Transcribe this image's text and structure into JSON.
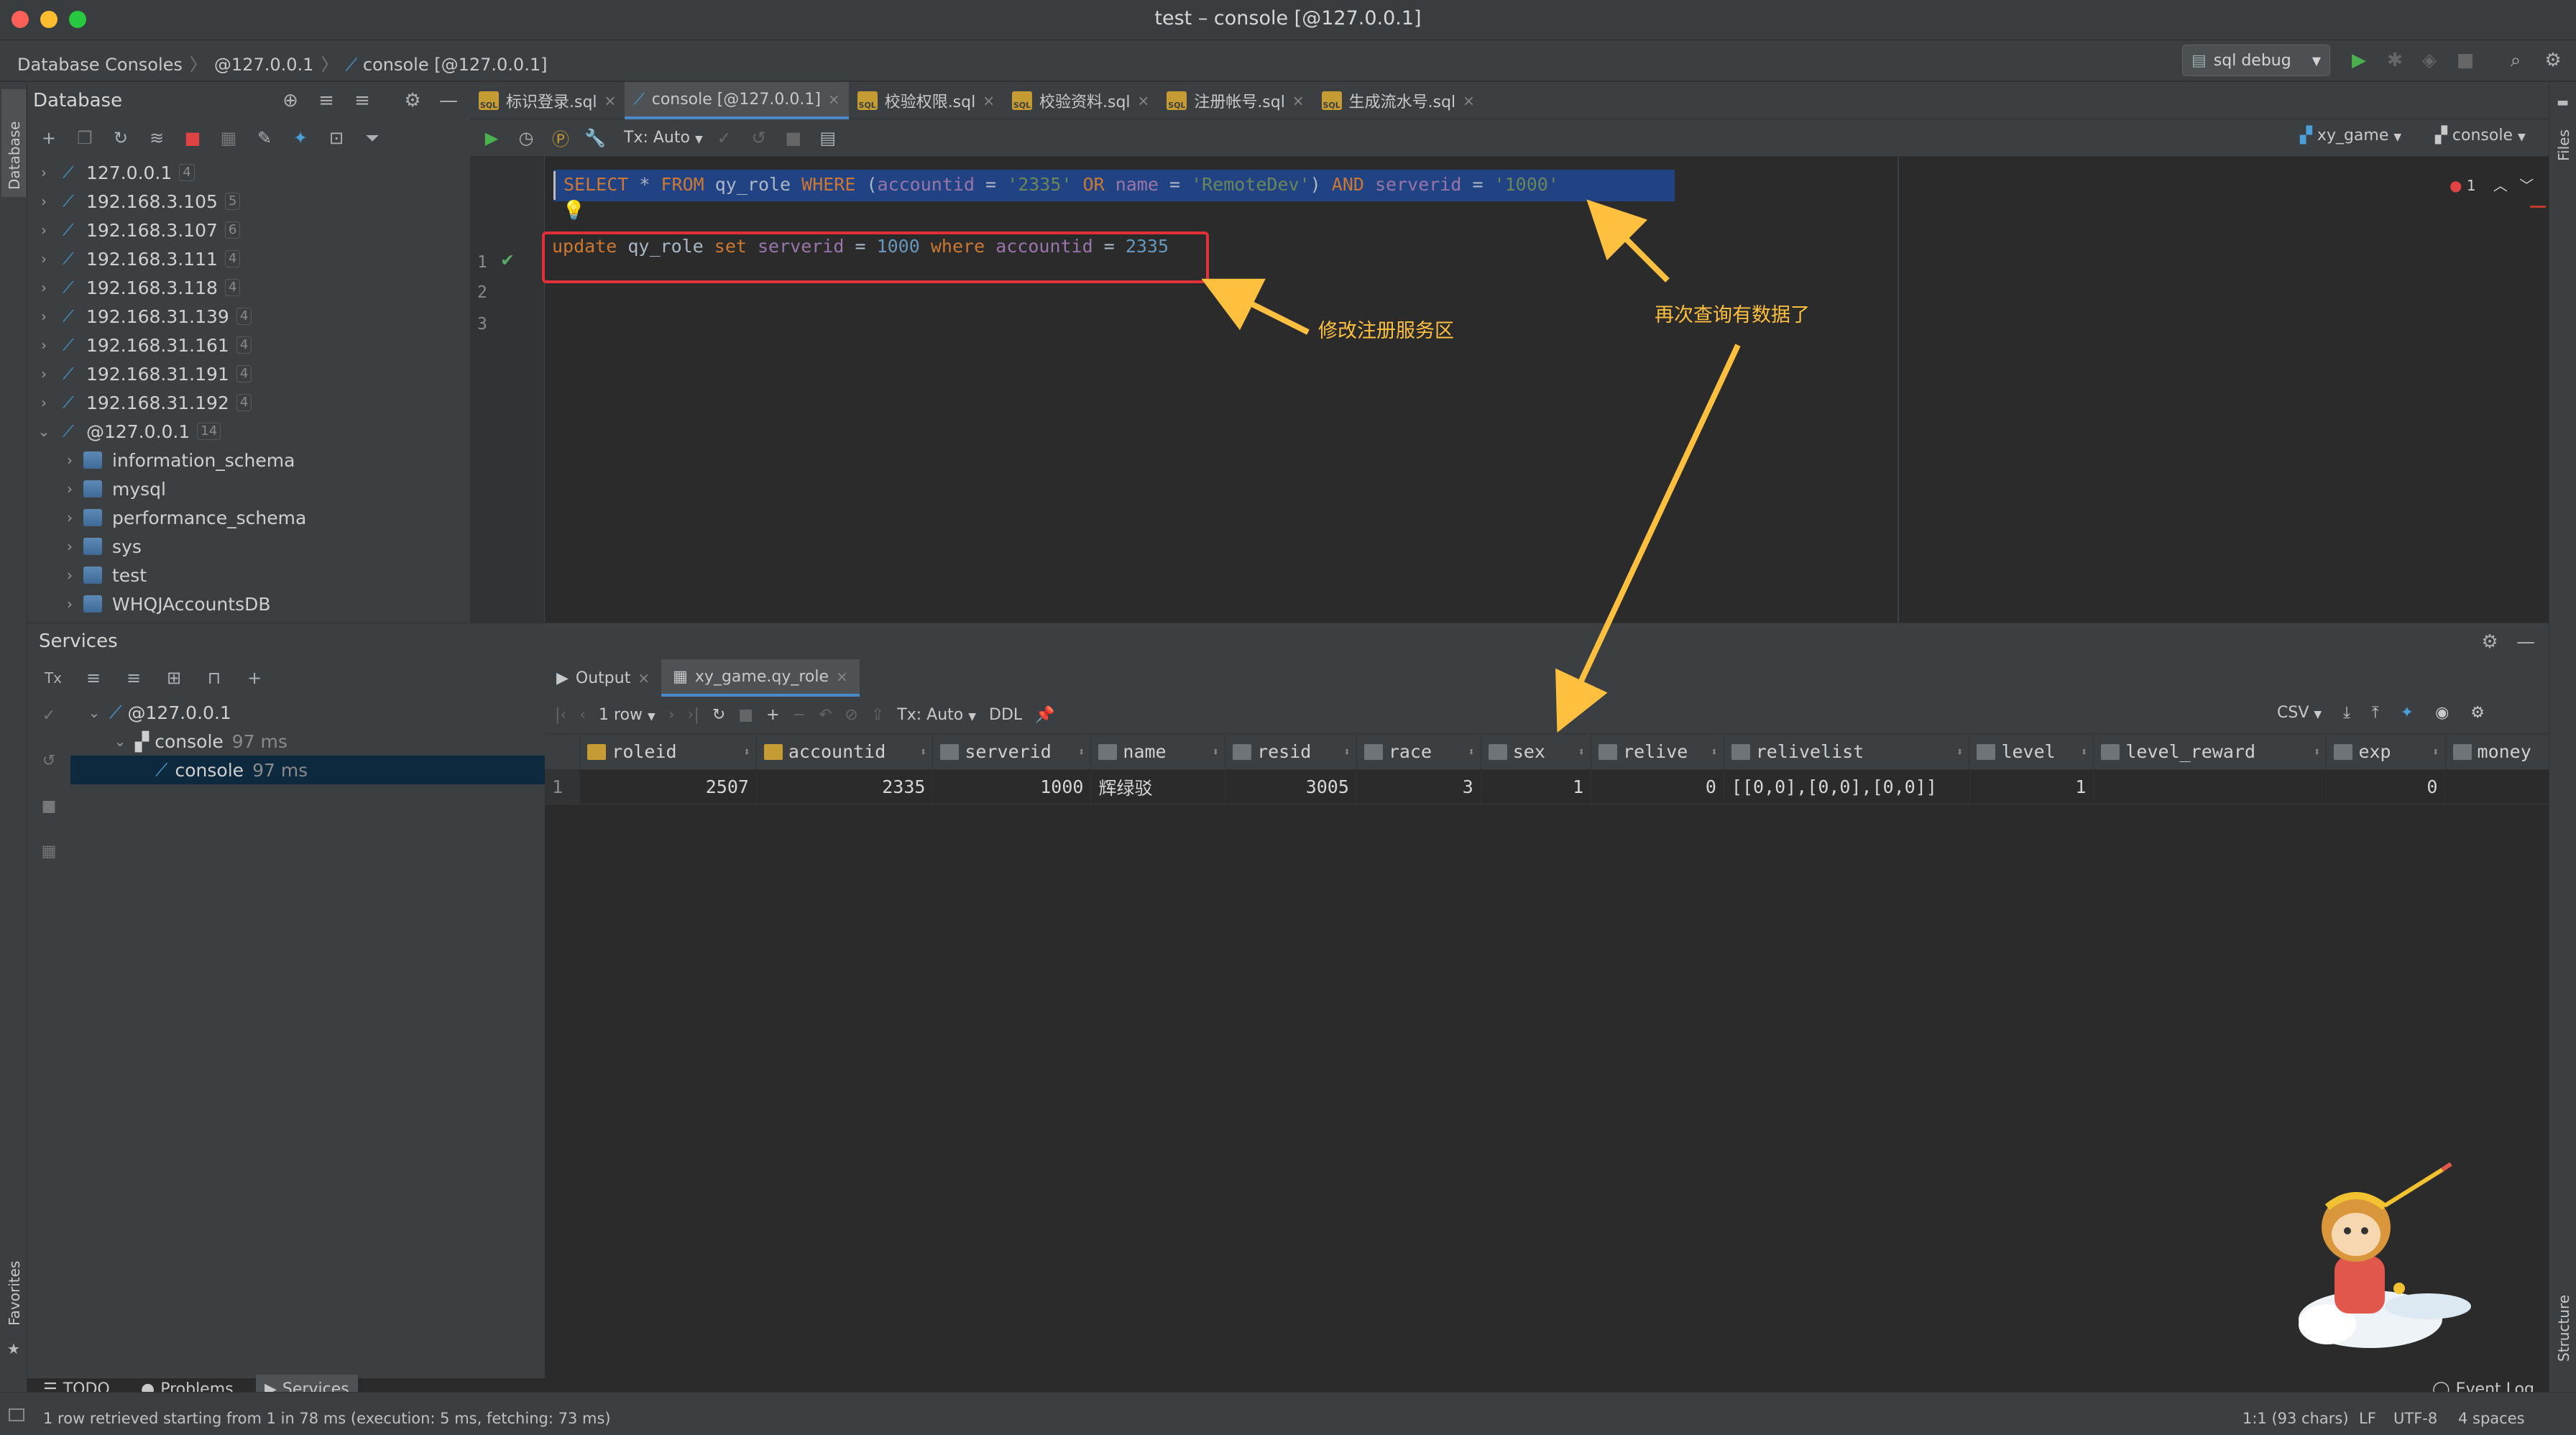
{
  "window": {
    "title": "test – console [@127.0.0.1]"
  },
  "navbar": {
    "crumbs": [
      "Database Consoles",
      "@127.0.0.1",
      "console [@127.0.0.1]"
    ],
    "run_config": "sql debug"
  },
  "db_panel": {
    "title": "Database",
    "tree": [
      {
        "label": "127.0.0.1",
        "count": "4"
      },
      {
        "label": "192.168.3.105",
        "count": "5"
      },
      {
        "label": "192.168.3.107",
        "count": "6"
      },
      {
        "label": "192.168.3.111",
        "count": "4"
      },
      {
        "label": "192.168.3.118",
        "count": "4"
      },
      {
        "label": "192.168.31.139",
        "count": "4"
      },
      {
        "label": "192.168.31.161",
        "count": "4"
      },
      {
        "label": "192.168.31.191",
        "count": "4"
      },
      {
        "label": "192.168.31.192",
        "count": "4"
      },
      {
        "label": "@127.0.0.1",
        "count": "14"
      }
    ],
    "schemas": [
      "information_schema",
      "mysql",
      "performance_schema",
      "sys",
      "test",
      "WHQJAccountsDB"
    ]
  },
  "editor": {
    "tabs": [
      "标识登录.sql",
      "console [@127.0.0.1]",
      "校验权限.sql",
      "校验资料.sql",
      "注册帐号.sql",
      "生成流水号.sql"
    ],
    "tx_mode": "Tx: Auto",
    "schema_selector": "xy_game",
    "console_selector": "console",
    "problems_count": "1",
    "lines": [
      "1",
      "2",
      "3"
    ],
    "line1": {
      "t1": "SELECT",
      "t2": " * ",
      "t3": "FROM",
      "t4": " qy_role ",
      "t5": "WHERE",
      "t6": " (",
      "t7": "accountid",
      "t8": " = ",
      "t9": "'2335'",
      "t10": " ",
      "t11": "OR",
      "t12": " ",
      "t13": "name",
      "t14": " = ",
      "t15": "'RemoteDev'",
      "t16": ") ",
      "t17": "AND",
      "t18": " ",
      "t19": "serverid",
      "t20": " = ",
      "t21": "'1000'"
    },
    "line3": {
      "t1": "update",
      "t2": " qy_role ",
      "t3": "set",
      "t4": " ",
      "t5": "serverid",
      "t6": " = ",
      "t7": "1000",
      "t8": " ",
      "t9": "where",
      "t10": " ",
      "t11": "accountid",
      "t12": " = ",
      "t13": "2335"
    }
  },
  "annotations": {
    "modify": "修改注册服务区",
    "query_again": "再次查询有数据了"
  },
  "services": {
    "title": "Services",
    "tree": [
      {
        "label": "@127.0.0.1",
        "time": ""
      },
      {
        "label": "console",
        "time": "97 ms"
      },
      {
        "label": "console",
        "time": "97 ms"
      }
    ],
    "result_tabs": [
      "Output",
      "xy_game.qy_role"
    ],
    "rows_label": "1 row",
    "tx_mode": "Tx: Auto",
    "ddl": "DDL",
    "export": "CSV",
    "columns": [
      "roleid",
      "accountid",
      "serverid",
      "name",
      "resid",
      "race",
      "sex",
      "relive",
      "relivelist",
      "level",
      "level_reward",
      "exp",
      "money"
    ],
    "rows": [
      [
        "1",
        "2507",
        "2335",
        "1000",
        "辉绿驳",
        "3005",
        "3",
        "1",
        "0",
        "[[0,0],[0,0],[0,0]]",
        "1",
        "",
        "0",
        ""
      ]
    ]
  },
  "bottom_tabs": {
    "todo": "TODO",
    "problems": "Problems",
    "services": "Services",
    "event_log": "Event Log"
  },
  "status": {
    "message": "1 row retrieved starting from 1 in 78 ms (execution: 5 ms, fetching: 73 ms)",
    "position": "1:1 (93 chars)",
    "line_sep": "LF",
    "encoding": "UTF-8",
    "indent": "4 spaces"
  },
  "side_labels": {
    "database": "Database",
    "favorites": "Favorites",
    "files": "Files",
    "structure": "Structure"
  },
  "colors": {
    "selection": "#214283",
    "annotation": "#ffc040",
    "highlight_box": "#e0303a",
    "accent": "#4a88c7"
  }
}
